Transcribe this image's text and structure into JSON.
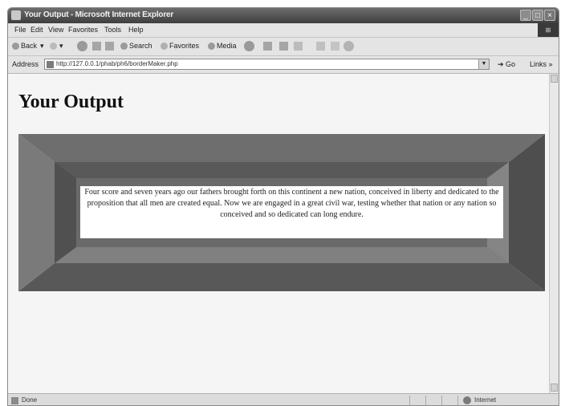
{
  "window": {
    "title": "Your Output - Microsoft Internet Explorer"
  },
  "menu": [
    "File",
    "Edit",
    "View",
    "Favorites",
    "Tools",
    "Help"
  ],
  "toolbar": {
    "back": "Back",
    "search": "Search",
    "favorites": "Favorites",
    "media": "Media"
  },
  "address": {
    "label": "Address",
    "url": "http://127.0.0.1/phab/ph6/borderMaker.php",
    "go": "Go",
    "links": "Links"
  },
  "page": {
    "heading": "Your Output",
    "quote": "Four score and seven years ago our fathers brought forth on this continent a new nation, conceived in liberty and dedicated to the proposition that all men are created equal. Now we are engaged in a great civil war, testing whether that nation or any nation so conceived and so dedicated can long endure."
  },
  "status": {
    "left": "Done",
    "zone": "Internet"
  },
  "colors": {
    "border_top": "#6e6e6e",
    "border_bottom": "#585858",
    "border_left": "#7a7a7a",
    "border_right": "#4e4e4e",
    "inner_field": "#6a6a6a",
    "inner_top": "#595959",
    "inner_bottom": "#808080",
    "inner_left": "#505050",
    "inner_right": "#858585",
    "quote_bg": "#ffffff"
  }
}
